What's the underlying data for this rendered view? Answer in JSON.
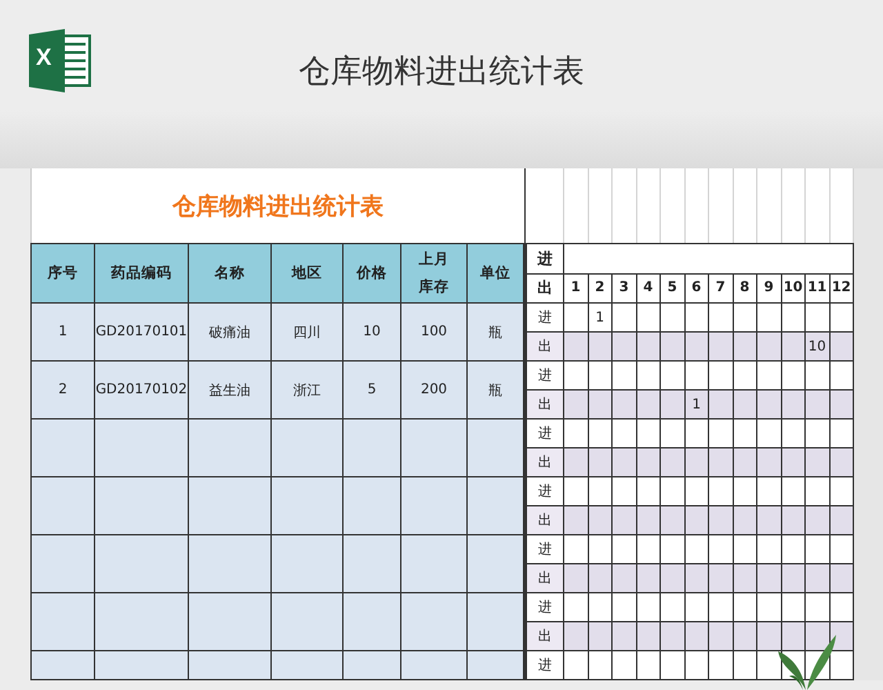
{
  "banner": {
    "logo_text": "X",
    "title": "仓库物料进出统计表"
  },
  "sheet": {
    "title": "仓库物料进出统计表",
    "columns": [
      "序号",
      "药品编码",
      "名称",
      "地区",
      "价格",
      "上月库存",
      "单位"
    ],
    "flow_header": [
      "进",
      "出"
    ],
    "months": [
      "1",
      "2",
      "3",
      "4",
      "5",
      "6",
      "7",
      "8",
      "9",
      "10",
      "11",
      "12"
    ],
    "rows": [
      {
        "cells": [
          "1",
          "GD20170101",
          "破痛油",
          "四川",
          "10",
          "100",
          "瓶"
        ],
        "flows": [
          {
            "label": "进",
            "values": {
              "1": "1"
            }
          },
          {
            "label": "出",
            "values": {
              "10": "10"
            }
          }
        ]
      },
      {
        "cells": [
          "2",
          "GD20170102",
          "益生油",
          "浙江",
          "5",
          "200",
          "瓶"
        ],
        "flows": [
          {
            "label": "进"
          },
          {
            "label": "出",
            "values": {
              "5": "1"
            }
          }
        ]
      },
      {
        "flows": [
          {
            "label": "进"
          },
          {
            "label": "出"
          }
        ]
      },
      {
        "flows": [
          {
            "label": "进"
          },
          {
            "label": "出"
          }
        ]
      },
      {
        "flows": [
          {
            "label": "进"
          },
          {
            "label": "出"
          }
        ]
      },
      {
        "flows": [
          {
            "label": "进"
          },
          {
            "label": "出"
          }
        ]
      },
      {
        "flows": [
          {
            "label": "进"
          }
        ]
      }
    ]
  }
}
